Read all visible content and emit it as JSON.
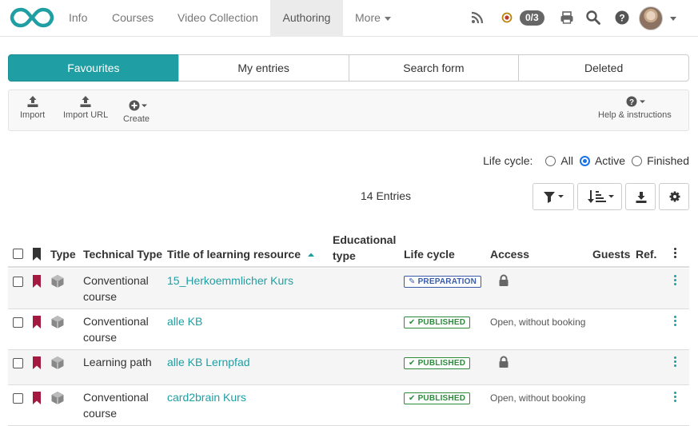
{
  "nav": {
    "items": [
      "Info",
      "Courses",
      "Video Collection",
      "Authoring",
      "More"
    ],
    "active": "Authoring",
    "counter_badge": "0/3"
  },
  "tabs": [
    "Favourites",
    "My entries",
    "Search form",
    "Deleted"
  ],
  "toolbar": {
    "import": "Import",
    "import_url": "Import URL",
    "create": "Create",
    "help": "Help & instructions"
  },
  "lifecycle_filter": {
    "label": "Life cycle:",
    "options": [
      "All",
      "Active",
      "Finished"
    ],
    "selected": "Active"
  },
  "entries_count": "14 Entries",
  "table": {
    "headers": {
      "type": "Type",
      "technical_type": "Technical Type",
      "title": "Title of learning resource",
      "educational_type": "Educational type",
      "life_cycle": "Life cycle",
      "access": "Access",
      "guests": "Guests",
      "ref": "Ref."
    },
    "rows": [
      {
        "technical_type": "Conventional course",
        "title": "15_Herkoemmlicher Kurs",
        "life_cycle": "PREPARATION",
        "access": ""
      },
      {
        "technical_type": "Conventional course",
        "title": "alle KB",
        "life_cycle": "PUBLISHED",
        "access": "Open, without booking"
      },
      {
        "technical_type": "Learning path",
        "title": "alle KB Lernpfad",
        "life_cycle": "PUBLISHED",
        "access": ""
      },
      {
        "technical_type": "Conventional course",
        "title": "card2brain Kurs",
        "life_cycle": "PUBLISHED",
        "access": "Open, without booking"
      }
    ]
  },
  "colors": {
    "accent": "#1f9fa3",
    "bookmark": "#a3193f",
    "preparation": "#3a5ca8",
    "published": "#2e8b3c"
  }
}
